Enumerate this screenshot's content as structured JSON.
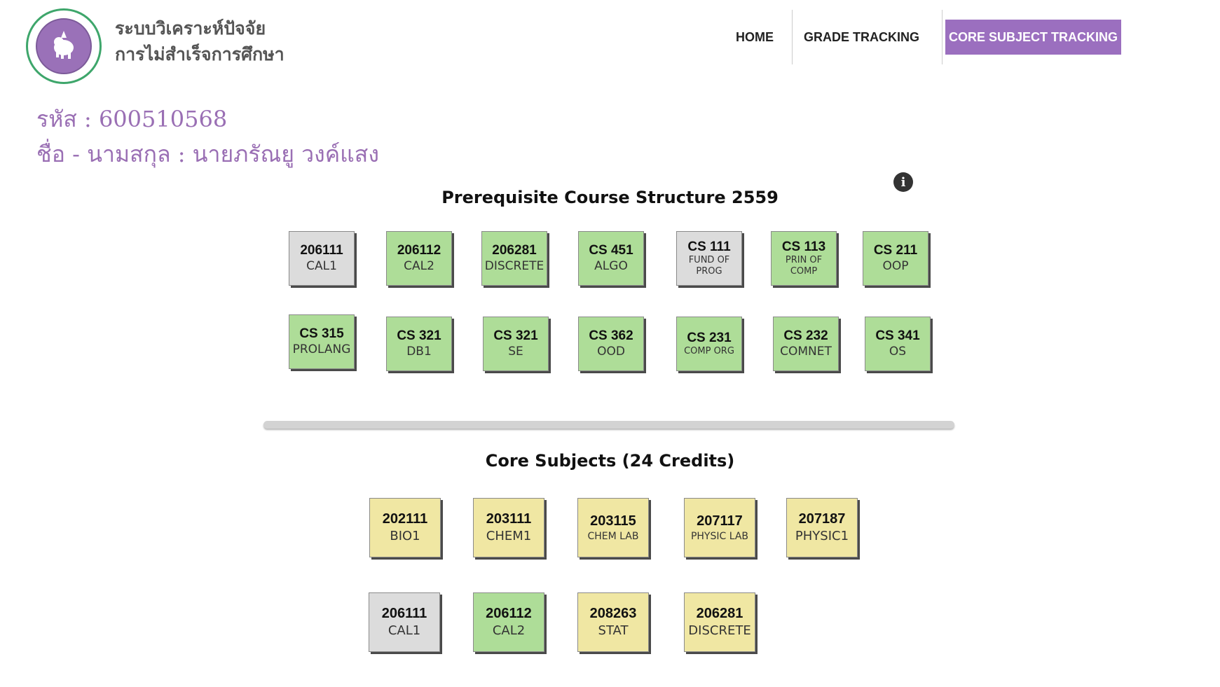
{
  "header": {
    "site_title_line1": "ระบบวิเคราะห์ปัจจัย",
    "site_title_line2": "การไม่สำเร็จการศึกษา",
    "nav": {
      "home": "HOME",
      "grade_tracking": "GRADE TRACKING",
      "core_subject_tracking": "CORE SUBJECT TRACKING"
    }
  },
  "student": {
    "id_line": "รหัส : 600510568",
    "name_line": "ชื่อ - นามสกุล : นายภรัณยู วงค์แสง"
  },
  "prerequisite": {
    "title": "Prerequisite Course Structure 2559",
    "info_icon": "i",
    "courses": [
      {
        "code": "206111",
        "name": "CAL1",
        "status": "gray"
      },
      {
        "code": "206112",
        "name": "CAL2",
        "status": "green"
      },
      {
        "code": "206281",
        "name": "DISCRETE",
        "status": "green"
      },
      {
        "code": "CS 451",
        "name": "ALGO",
        "status": "green"
      },
      {
        "code": "CS 111",
        "name_line1": "FUND OF",
        "name_line2": "PROG",
        "status": "gray"
      },
      {
        "code": "CS 113",
        "name_line1": "PRIN OF",
        "name_line2": "COMP",
        "status": "green"
      },
      {
        "code": "CS 211",
        "name": "OOP",
        "status": "green"
      },
      {
        "code": "CS 315",
        "name": "PROLANG",
        "status": "green"
      },
      {
        "code": "CS 321",
        "name": "DB1",
        "status": "green"
      },
      {
        "code": "CS 321",
        "name": "SE",
        "status": "green"
      },
      {
        "code": "CS 362",
        "name": "OOD",
        "status": "green"
      },
      {
        "code": "CS 231",
        "name": "COMP ORG",
        "status": "green"
      },
      {
        "code": "CS 232",
        "name": "COMNET",
        "status": "green"
      },
      {
        "code": "CS 341",
        "name": "OS",
        "status": "green"
      }
    ]
  },
  "core": {
    "title": "Core Subjects (24 Credits)",
    "courses": [
      {
        "code": "202111",
        "name": "BIO1",
        "status": "yellow"
      },
      {
        "code": "203111",
        "name": "CHEM1",
        "status": "yellow"
      },
      {
        "code": "203115",
        "name": "CHEM LAB",
        "status": "yellow"
      },
      {
        "code": "207117",
        "name": "PHYSIC LAB",
        "status": "yellow"
      },
      {
        "code": "207187",
        "name": "PHYSIC1",
        "status": "yellow"
      },
      {
        "code": "206111",
        "name": "CAL1",
        "status": "gray"
      },
      {
        "code": "206112",
        "name": "CAL2",
        "status": "green"
      },
      {
        "code": "208263",
        "name": "STAT",
        "status": "yellow"
      },
      {
        "code": "206281",
        "name": "DISCRETE",
        "status": "yellow"
      }
    ]
  },
  "colors": {
    "passed": "#aedd98",
    "not_taken": "#dcdcdc",
    "core_pending": "#f0e7a3",
    "accent": "#9b6fbf"
  }
}
